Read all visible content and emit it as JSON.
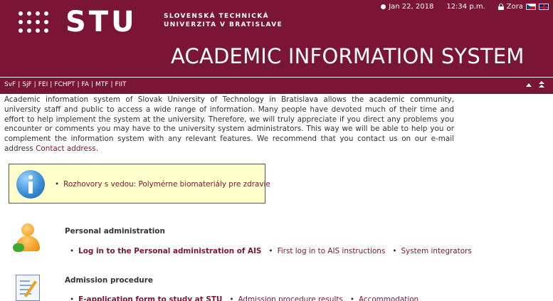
{
  "header": {
    "logo_text": "STU",
    "university_line1": "SLOVENSKÁ TECHNICKÁ",
    "university_line2": "UNIVERZITA V BRATISLAVE",
    "date": "Jan 22, 2018",
    "time": "12:34 p.m.",
    "user_link": "Zora",
    "app_title": "ACADEMIC INFORMATION SYSTEM"
  },
  "nav": {
    "faculties": [
      "SvF",
      "SjF",
      "FEI",
      "FCHPT",
      "FA",
      "MTF",
      "FIIT"
    ]
  },
  "intro": {
    "text": "Academic information system of Slovak University of Technology in Bratislava allows the academic community, university staff and public to access a wide range of information. Many people have devoted much of their time and effort to help implement the system at the university. Therefore, we will truly appreciate if you direct any problems you encounter or comments you may have to the university system administrators. This way we will be able to help you or complement the information system with any relevant features. We recommend that you contact us on our e-mail address ",
    "link": "Contact address",
    "end": "."
  },
  "news": {
    "item": "Rozhovory s vedou: Polymérne biomateriály pre zdravie"
  },
  "sections": {
    "personal": {
      "title": "Personal administration",
      "links": [
        "Log in to the Personal administration of AIS",
        "First log in to AIS instructions",
        "System integrators"
      ]
    },
    "admission": {
      "title": "Admission procedure",
      "links": [
        "E-application form to study at STU",
        "Admission procedure results",
        "Accommodation"
      ]
    }
  },
  "colors": {
    "brand": "#7b1535",
    "news_bg": "#ffffcc"
  }
}
